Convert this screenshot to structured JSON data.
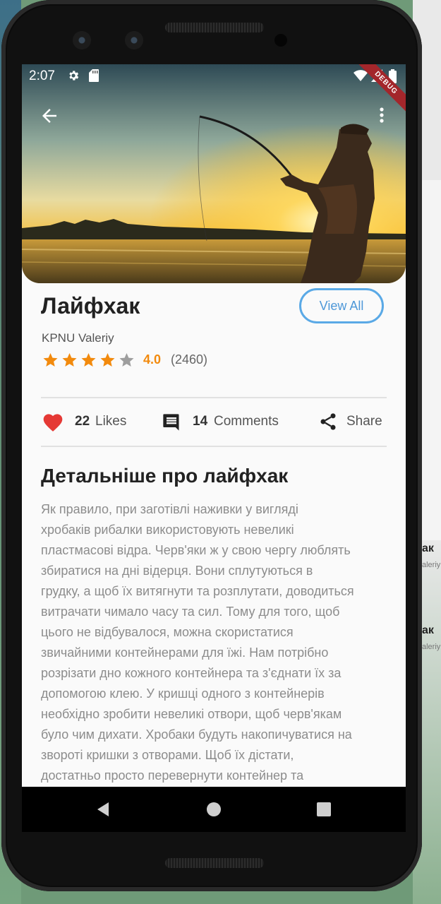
{
  "status_bar": {
    "time": "2:07",
    "debug": "DEBUG"
  },
  "header": {
    "back_icon": "arrow-left-icon",
    "menu_icon": "more-vert-icon"
  },
  "post": {
    "title": "Лайфхак",
    "view_all_label": "View All",
    "author": "KPNU Valeriy",
    "rating_value": "4.0",
    "rating_count": "(2460)",
    "rating_stars": 4,
    "rating_max": 5,
    "star_color": "#f28a0d"
  },
  "actions": {
    "likes_count": "22",
    "likes_label": "Likes",
    "comments_count": "14",
    "comments_label": "Comments",
    "share_label": "Share",
    "like_color": "#e53935"
  },
  "details": {
    "title": "Детальніше про лайфхак",
    "lines": [
      "Як правило, при заготівлі наживки у вигляді",
      "хробаків рибалки використовують невеликі",
      "пластмасові відра. Черв'яки ж у свою чергу люблять",
      "збиратися на дні відерця. Вони сплутуються в",
      "грудку, а щоб їх витягнути та розплутати, доводиться",
      "витрачати чимало часу та сил. Тому для того, щоб",
      "цього не відбувалося, можна скористатися",
      "звичайними контейнерами для їжі. Нам потрібно",
      "розрізати дно кожного контейнера та з'єднати їх за",
      "допомогою клею. У кришці одного з контейнерів",
      "необхідно зробити невеликі отвори, щоб черв'якам",
      "було чим дихати. Хробаки будуть накопичуватися на",
      "звороті кришки з отворами. Щоб їх дістати,",
      "достатньо просто перевернути контейнер та"
    ]
  },
  "background_app": {
    "title_fragment_1": "ак",
    "author_fragment_1": "aleriy",
    "title_fragment_2": "ак",
    "author_fragment_2": "aleriy"
  }
}
